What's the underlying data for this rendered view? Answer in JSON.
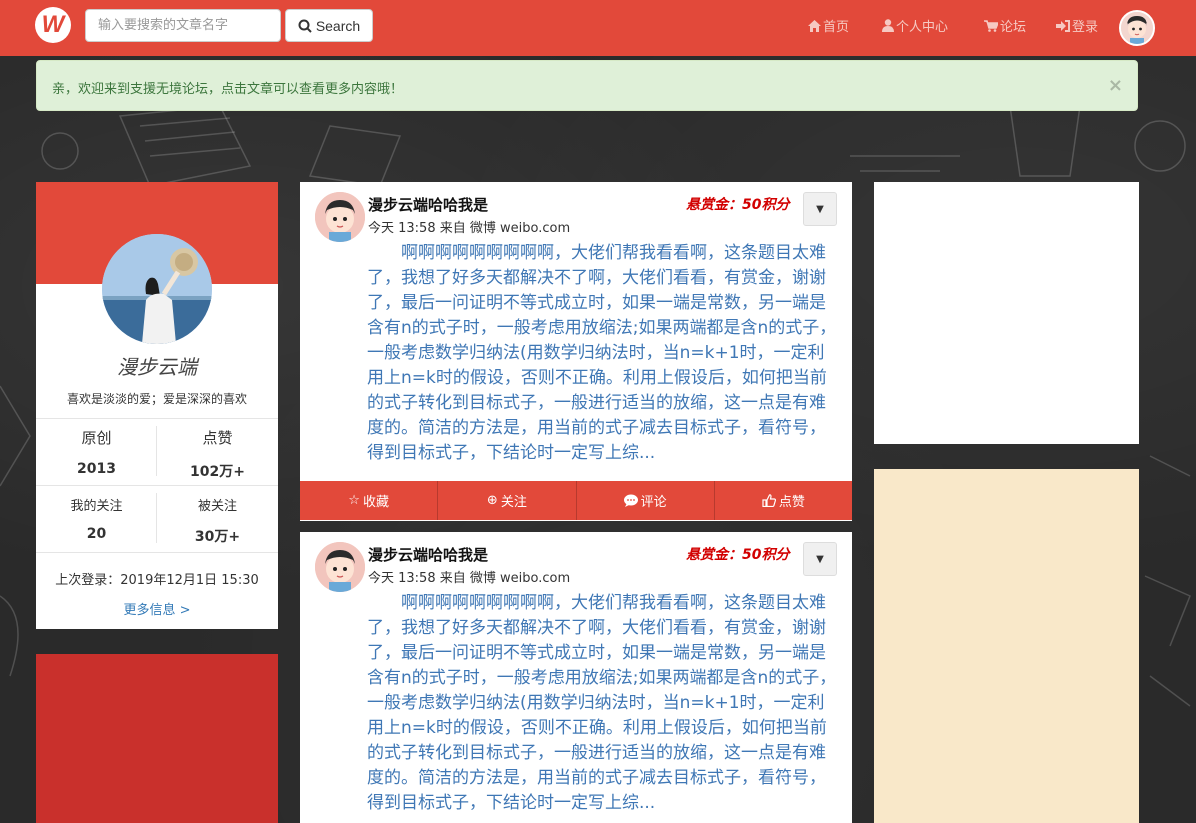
{
  "header": {
    "logo_text": "W",
    "search_placeholder": "输入要搜索的文章名字",
    "search_button": "Search",
    "nav": [
      {
        "icon": "home-icon",
        "label": "首页"
      },
      {
        "icon": "user-icon",
        "label": "个人中心"
      },
      {
        "icon": "cart-icon",
        "label": "论坛"
      },
      {
        "icon": "login-icon",
        "label": "登录"
      }
    ]
  },
  "alert": {
    "message": "亲，欢迎来到支援无境论坛，点击文章可以查看更多内容哦！",
    "close": "×"
  },
  "profile": {
    "name": "漫步云端",
    "motto": "喜欢是淡淡的爱；爱是深深的喜欢",
    "stats": [
      {
        "label": "原创",
        "value": "2013"
      },
      {
        "label": "点赞",
        "value": "102万+"
      },
      {
        "label": "我的关注",
        "value": "20"
      },
      {
        "label": "被关注",
        "value": "30万+"
      }
    ],
    "last_login": "上次登录：2019年12月1日 15:30",
    "more_info": "更多信息 >"
  },
  "posts": [
    {
      "author": "漫步云端哈哈我是",
      "meta": "今天  13:58  来自 微博 weibo.com",
      "reward": "悬赏金：50积分",
      "body": "啊啊啊啊啊啊啊啊啊，大佬们帮我看看啊，这条题目太难了，我想了好多天都解决不了啊，大佬们看看，有赏金，谢谢了，最后一问证明不等式成立时，如果一端是常数，另一端是含有n的式子时，一般考虑用放缩法;如果两端都是含n的式子，一般考虑数学归纳法(用数学归纳法时，当n=k+1时，一定利用上n=k时的假设，否则不正确。利用上假设后，如何把当前的式子转化到目标式子，一般进行适当的放缩，这一点是有难度的。简洁的方法是，用当前的式子减去目标式子，看符号，得到目标式子，下结论时一定写上综...",
      "actions": [
        "收藏",
        "关注",
        "评论",
        "点赞"
      ]
    },
    {
      "author": "漫步云端哈哈我是",
      "meta": "今天  13:58  来自 微博 weibo.com",
      "reward": "悬赏金：50积分",
      "body": "啊啊啊啊啊啊啊啊啊，大佬们帮我看看啊，这条题目太难了，我想了好多天都解决不了啊，大佬们看看，有赏金，谢谢了，最后一问证明不等式成立时，如果一端是常数，另一端是含有n的式子时，一般考虑用放缩法;如果两端都是含n的式子，一般考虑数学归纳法(用数学归纳法时，当n=k+1时，一定利用上n=k时的假设，否则不正确。利用上假设后，如何把当前的式子转化到目标式子，一般进行适当的放缩，这一点是有难度的。简洁的方法是，用当前的式子减去目标式子，看符号，得到目标式子，下结论时一定写上综..."
    }
  ],
  "colors": {
    "brand_red": "#e2493a",
    "alert_bg": "#dff0d8",
    "link_blue": "#337ab7",
    "reward_red": "#d20000",
    "beige": "#f9e8c9"
  }
}
